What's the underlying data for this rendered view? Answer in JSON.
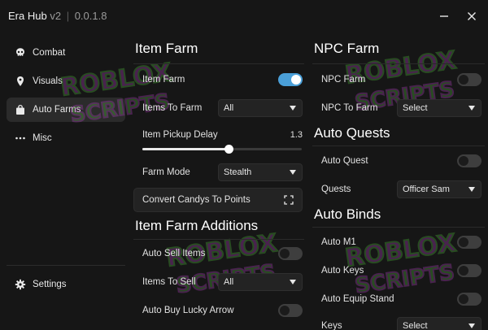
{
  "window": {
    "app_name": "Era Hub",
    "version": "v2",
    "separator": "|",
    "build": "0.0.1.8"
  },
  "sidebar": {
    "items": [
      {
        "label": "Combat",
        "icon": "skull-icon"
      },
      {
        "label": "Visuals",
        "icon": "map-pin-icon"
      },
      {
        "label": "Auto Farms",
        "icon": "shopping-bag-icon",
        "active": true
      },
      {
        "label": "Misc",
        "icon": "ellipsis-icon"
      }
    ],
    "settings_label": "Settings"
  },
  "left": {
    "item_farm": {
      "title": "Item Farm",
      "item_farm_label": "Item Farm",
      "item_farm_on": true,
      "items_to_farm_label": "Items To Farm",
      "items_to_farm_value": "All",
      "pickup_delay_label": "Item Pickup Delay",
      "pickup_delay_value": "1.3",
      "pickup_delay_fraction": 0.54,
      "farm_mode_label": "Farm Mode",
      "farm_mode_value": "Stealth",
      "convert_label": "Convert Candys To Points"
    },
    "additions": {
      "title": "Item Farm Additions",
      "auto_sell_label": "Auto Sell Items",
      "auto_sell_on": false,
      "items_to_sell_label": "Items To Sell",
      "items_to_sell_value": "All",
      "lucky_arrow_label": "Auto Buy Lucky Arrow",
      "lucky_arrow_on": false
    }
  },
  "right": {
    "npc_farm": {
      "title": "NPC Farm",
      "npc_farm_label": "NPC Farm",
      "npc_farm_on": false,
      "npc_to_farm_label": "NPC To Farm",
      "npc_to_farm_value": "Select"
    },
    "auto_quests": {
      "title": "Auto Quests",
      "auto_quest_label": "Auto Quest",
      "auto_quest_on": false,
      "quests_label": "Quests",
      "quests_value": "Officer Sam"
    },
    "auto_binds": {
      "title": "Auto Binds",
      "auto_m1_label": "Auto M1",
      "auto_m1_on": false,
      "auto_keys_label": "Auto Keys",
      "auto_keys_on": false,
      "auto_equip_label": "Auto Equip Stand",
      "auto_equip_on": false,
      "keys_label": "Keys",
      "keys_value": "Select"
    }
  },
  "watermark": {
    "line1": "ROBLOX",
    "line2": "SCRIPTS"
  },
  "colors": {
    "accent": "#4a9fd8",
    "background": "#161616",
    "panel": "#232323",
    "watermark_green": "#4fbf3a",
    "watermark_purple": "#b43fc4"
  }
}
